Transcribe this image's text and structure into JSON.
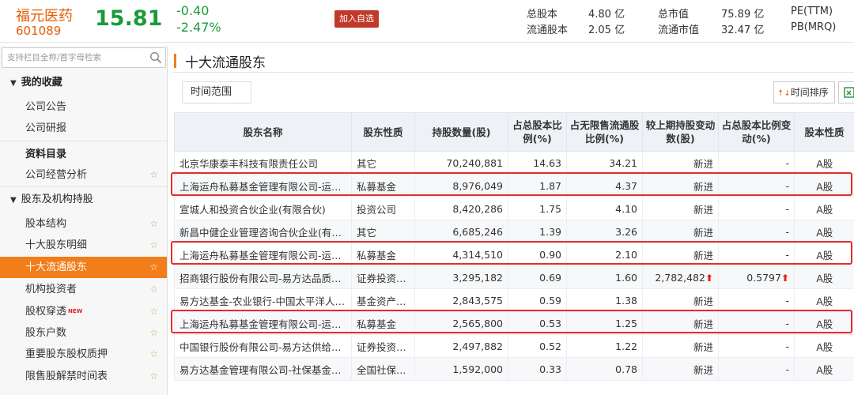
{
  "header": {
    "stock_name": "福元医药",
    "stock_code": "601089",
    "price": "15.81",
    "change_abs": "-0.40",
    "change_pct": "-2.47%",
    "watch_button": "加入自选",
    "stats": [
      {
        "label": "总股本",
        "value": "4.80 亿"
      },
      {
        "label": "流通股本",
        "value": "2.05 亿"
      },
      {
        "label": "总市值",
        "value": "75.89 亿"
      },
      {
        "label": "流通市值",
        "value": "32.47 亿"
      },
      {
        "label": "PE(TTM)",
        "value": ""
      },
      {
        "label": "PB(MRQ)",
        "value": ""
      }
    ]
  },
  "sidebar": {
    "search_placeholder": "支持栏目全称/首字母检索",
    "favorites_title": "我的收藏",
    "favorites": [
      "公司公告",
      "公司研报"
    ],
    "catalog_title": "资料目录",
    "catalog_first": "公司经营分析",
    "holders_section": "股东及机构持股",
    "holders_items": [
      "股本结构",
      "十大股东明细",
      "十大流通股东",
      "机构投资者",
      "股权穿透",
      "股东户数",
      "重要股东股权质押",
      "限售股解禁时间表"
    ],
    "new_badge": "NEW",
    "star": "☆"
  },
  "main": {
    "title": "十大流通股东",
    "range_button": "时间范围",
    "sort_button": "时间排序",
    "columns": [
      "股东名称",
      "股东性质",
      "持股数量(股)",
      "占总股本比例(%)",
      "占无限售流通股比例(%)",
      "较上期持股变动数(股)",
      "占总股本比例变动(%)",
      "股本性质"
    ],
    "rows": [
      [
        "北京华康泰丰科技有限责任公司",
        "其它",
        "70,240,881",
        "14.63",
        "34.21",
        "新进",
        "-",
        "A股"
      ],
      [
        "上海运舟私募基金管理有限公司-运…",
        "私募基金",
        "8,976,049",
        "1.87",
        "4.37",
        "新进",
        "-",
        "A股"
      ],
      [
        "宣城人和投资合伙企业(有限合伙)",
        "投资公司",
        "8,420,286",
        "1.75",
        "4.10",
        "新进",
        "-",
        "A股"
      ],
      [
        "新昌中健企业管理咨询合伙企业(有…",
        "其它",
        "6,685,246",
        "1.39",
        "3.26",
        "新进",
        "-",
        "A股"
      ],
      [
        "上海运舟私募基金管理有限公司-运…",
        "私募基金",
        "4,314,510",
        "0.90",
        "2.10",
        "新进",
        "-",
        "A股"
      ],
      [
        "招商银行股份有限公司-易方达品质…",
        "证券投资…",
        "3,295,182",
        "0.69",
        "1.60",
        "2,782,482",
        "0.5797",
        "A股"
      ],
      [
        "易方达基金-农业银行-中国太平洋人…",
        "基金资产…",
        "2,843,575",
        "0.59",
        "1.38",
        "新进",
        "-",
        "A股"
      ],
      [
        "上海运舟私募基金管理有限公司-运…",
        "私募基金",
        "2,565,800",
        "0.53",
        "1.25",
        "新进",
        "-",
        "A股"
      ],
      [
        "中国银行股份有限公司-易方达供给…",
        "证券投资…",
        "2,497,882",
        "0.52",
        "1.22",
        "新进",
        "-",
        "A股"
      ],
      [
        "易方达基金管理有限公司-社保基金…",
        "全国社保…",
        "1,592,000",
        "0.33",
        "0.78",
        "新进",
        "-",
        "A股"
      ]
    ],
    "up_arrow": "⬆",
    "highlight_color": "#e52b2b"
  }
}
